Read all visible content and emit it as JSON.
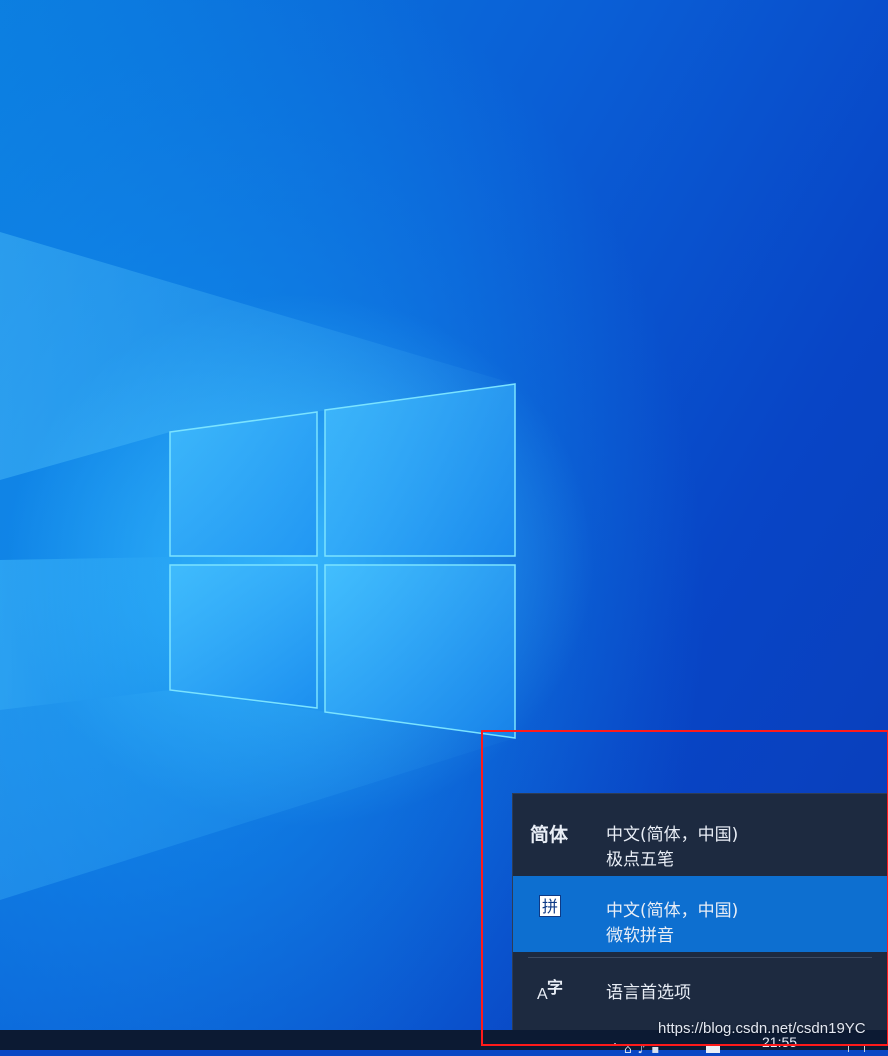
{
  "colors": {
    "desktop_background": "#0a47c4",
    "ime_panel_background": "#1d2a40",
    "ime_selected_background": "#0d6fd0",
    "highlight_border": "#ff1a1a",
    "taskbar_background": "#0c1a33"
  },
  "ime_menu": {
    "items": [
      {
        "badge": "简体",
        "language": "中文(简体，中国)",
        "method": "极点五笔",
        "selected": false
      },
      {
        "badge": "拼",
        "language": "中文(简体，中国)",
        "method": "微软拼音",
        "selected": true
      }
    ],
    "preferences": {
      "badge_letter": "A",
      "badge_char": "字",
      "label": "语言首选项"
    }
  },
  "taskbar": {
    "clock": "21:55",
    "tray_icons": [
      "show-hidden-icons",
      "network-icon",
      "volume-icon",
      "input-mode-indicator",
      "ime-icon"
    ]
  },
  "watermark": {
    "text": "https://blog.csdn.net/csdn19YC"
  }
}
